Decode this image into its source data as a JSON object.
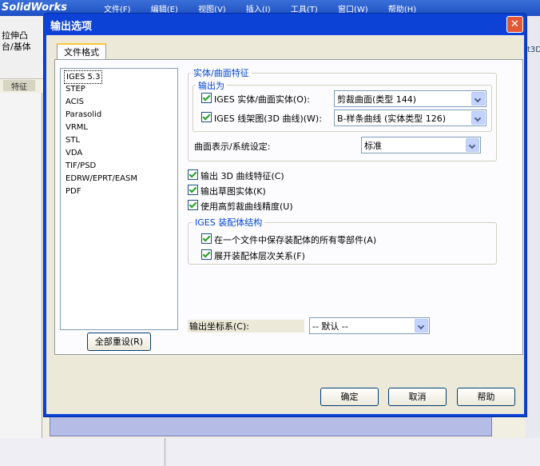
{
  "background_app": {
    "logo": "SolidWorks",
    "menu": [
      "文件(F)",
      "编辑(E)",
      "视图(V)",
      "插入(I)",
      "工具(T)",
      "窗口(W)",
      "帮助(H)"
    ],
    "extrude_label": "拉伸凸\n台/基体",
    "feature_tab": "特征",
    "right_code": "t3D"
  },
  "dialog": {
    "title": "输出选项",
    "close_glyph": "✕",
    "tab_label": "文件格式",
    "formats": [
      "IGES 5.3",
      "STEP",
      "ACIS",
      "Parasolid",
      "VRML",
      "STL",
      "VDA",
      "TIF/PSD",
      "EDRW/EPRT/EASM",
      "PDF"
    ],
    "selected_format": "IGES 5.3",
    "reset_button": "全部重设(R)",
    "solid_surface": {
      "legend": "实体/曲面特征",
      "output_as_legend": "输出为",
      "iges_solid_label": "IGES 实体/曲面实体(O):",
      "iges_solid_checked": true,
      "iges_solid_value": "剪裁曲面(类型 144)",
      "iges_wire_label": "IGES 线架图(3D 曲线)(W):",
      "iges_wire_checked": true,
      "iges_wire_value": "B-样条曲线 (实体类型 126)",
      "surface_rep_label": "曲面表示/系统设定:",
      "surface_rep_value": "标准"
    },
    "options": [
      {
        "label": "输出 3D 曲线特征(C)",
        "checked": true
      },
      {
        "label": "输出草图实体(K)",
        "checked": true
      },
      {
        "label": "使用高剪裁曲线精度(U)",
        "checked": true
      }
    ],
    "assembly": {
      "legend": "IGES 装配体结构",
      "items": [
        {
          "label": "在一个文件中保存装配体的所有零部件(A)",
          "checked": true
        },
        {
          "label": "展开装配体层次关系(F)",
          "checked": true
        }
      ]
    },
    "coord": {
      "label": "输出坐标系(C):",
      "value": "-- 默认 --"
    },
    "buttons": {
      "ok": "确定",
      "cancel": "取消",
      "help": "帮助"
    }
  }
}
